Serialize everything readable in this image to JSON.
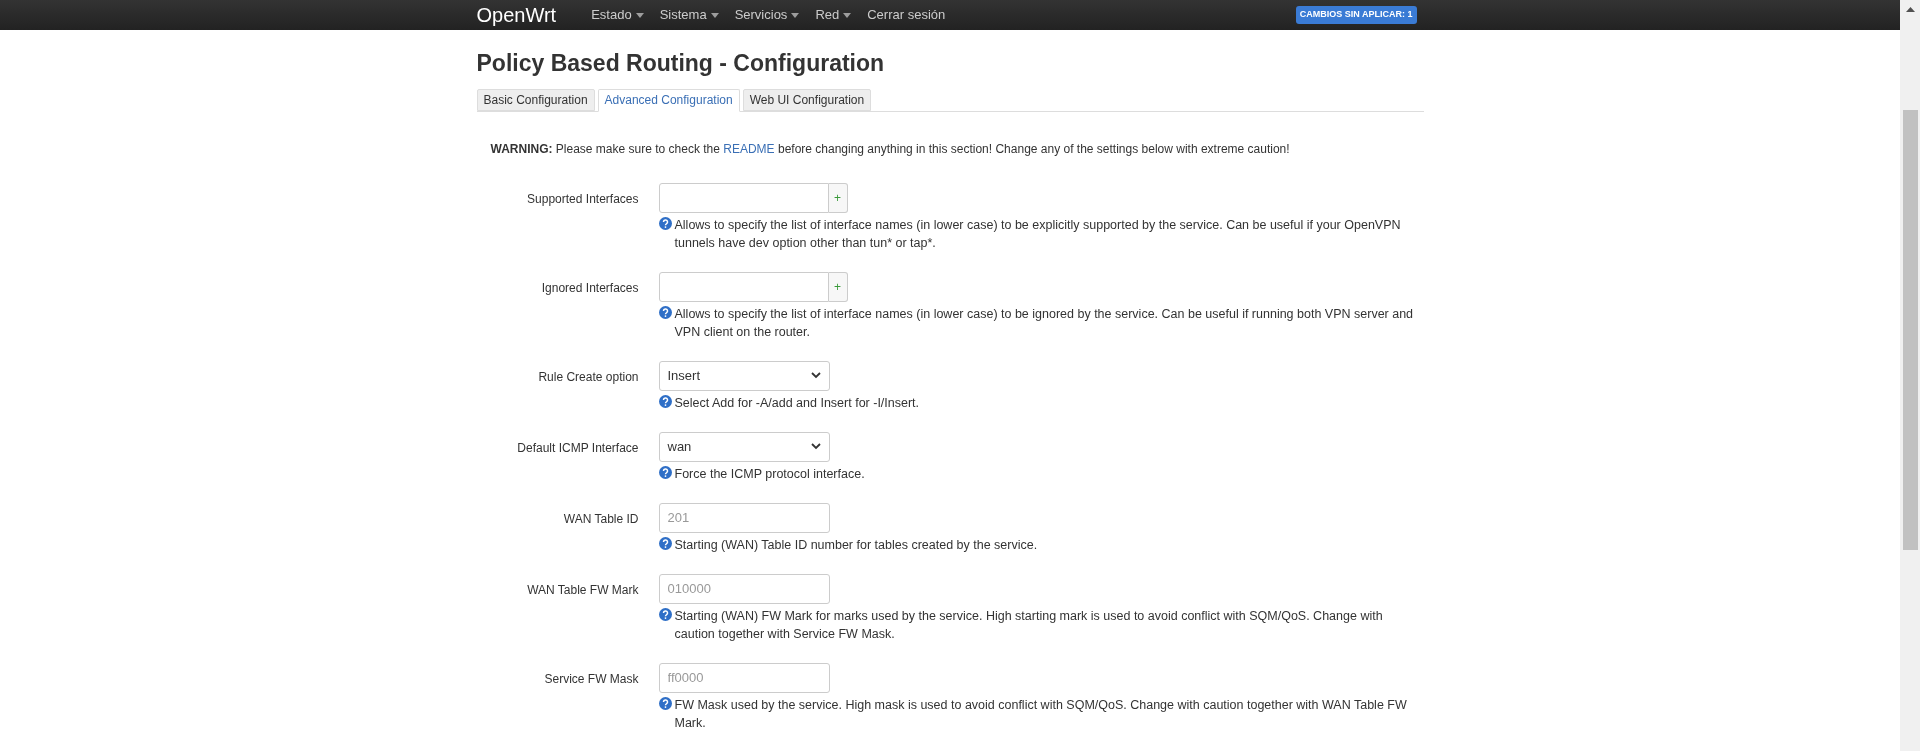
{
  "navbar": {
    "brand": "OpenWrt",
    "menu": [
      {
        "label": "Estado",
        "dropdown": true
      },
      {
        "label": "Sistema",
        "dropdown": true
      },
      {
        "label": "Servicios",
        "dropdown": true
      },
      {
        "label": "Red",
        "dropdown": true
      },
      {
        "label": "Cerrar sesión",
        "dropdown": false
      }
    ],
    "badge": "CAMBIOS SIN APLICAR: 1"
  },
  "page": {
    "title": "Policy Based Routing - Configuration",
    "tabs": [
      {
        "label": "Basic Configuration",
        "selected": false
      },
      {
        "label": "Advanced Configuration",
        "selected": true
      },
      {
        "label": "Web UI Configuration",
        "selected": false
      }
    ],
    "warning": {
      "lead": "WARNING:",
      "before": "Please make sure to check the",
      "link": "README",
      "after": "before changing anything in this section! Change any of the settings below with extreme caution!"
    },
    "fields": [
      {
        "kind": "dynlist",
        "label": "Supported Interfaces",
        "add": "+",
        "help": "Allows to specify the list of interface names (in lower case) to be explicitly supported by the service. Can be useful if your OpenVPN tunnels have dev option other than tun* or tap*."
      },
      {
        "kind": "dynlist",
        "label": "Ignored Interfaces",
        "add": "+",
        "help": "Allows to specify the list of interface names (in lower case) to be ignored by the service. Can be useful if running both VPN server and VPN client on the router."
      },
      {
        "kind": "select",
        "label": "Rule Create option",
        "value": "Insert",
        "help": "Select Add for -A/add and Insert for -I/Insert."
      },
      {
        "kind": "select",
        "label": "Default ICMP Interface",
        "value": "wan",
        "help": "Force the ICMP protocol interface."
      },
      {
        "kind": "text",
        "label": "WAN Table ID",
        "placeholder": "201",
        "help": "Starting (WAN) Table ID number for tables created by the service."
      },
      {
        "kind": "text",
        "label": "WAN Table FW Mark",
        "placeholder": "010000",
        "help": "Starting (WAN) FW Mark for marks used by the service. High starting mark is used to avoid conflict with SQM/QoS. Change with caution together with Service FW Mask."
      },
      {
        "kind": "text",
        "label": "Service FW Mask",
        "placeholder": "ff0000",
        "help": "FW Mask used by the service. High mask is used to avoid conflict with SQM/QoS. Change with caution together with WAN Table FW Mark."
      }
    ]
  }
}
